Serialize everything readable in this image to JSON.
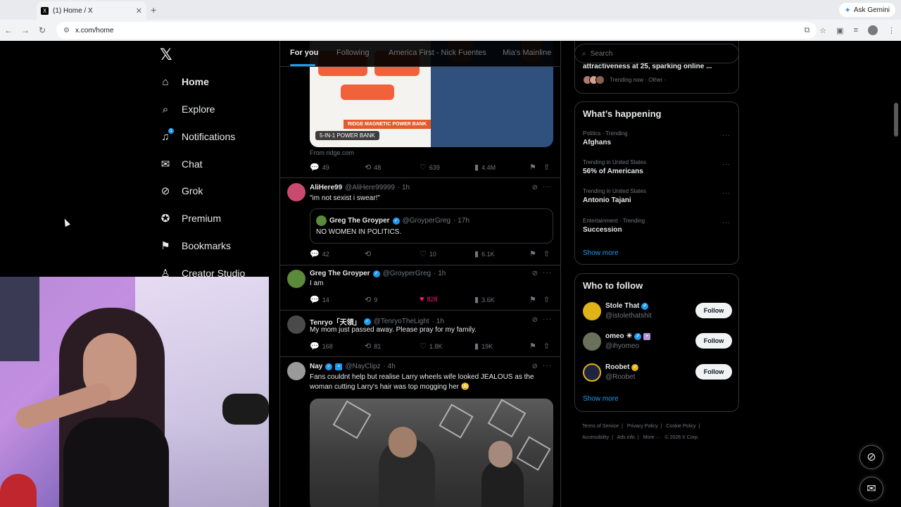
{
  "browser": {
    "tab_title": "(1) Home / X",
    "new_tab": "+",
    "tab_close": "✕",
    "address": "x.com/home",
    "gemini_label": "Ask Gemini"
  },
  "nav": {
    "logo": "𝕏",
    "items": [
      {
        "label": "Home",
        "icon": "home-icon"
      },
      {
        "label": "Explore",
        "icon": "search-icon"
      },
      {
        "label": "Notifications",
        "icon": "bell-icon",
        "badge": "1"
      },
      {
        "label": "Chat",
        "icon": "mail-icon"
      },
      {
        "label": "Grok",
        "icon": "grok-icon"
      },
      {
        "label": "Premium",
        "icon": "premium-icon"
      },
      {
        "label": "Bookmarks",
        "icon": "bookmark-icon"
      },
      {
        "label": "Creator Studio",
        "icon": "creator-studio-icon"
      }
    ]
  },
  "feed": {
    "tabs": [
      "For you",
      "Following",
      "America First - Nick Fuentes",
      "Mia's Mainline"
    ],
    "ad": {
      "badge": "RIDGE MAGNETIC POWER BANK",
      "label": "5-IN-1 POWER BANK",
      "from": "From ridge.com",
      "replies": "49",
      "reposts": "48",
      "likes": "639",
      "views": "4.4M"
    },
    "posts": [
      {
        "name": "AliHere99",
        "handle": "@AliHere99999",
        "time": "· 1h",
        "text": "\"im not sexist i swear!\"",
        "quote": {
          "name": "Greg The Groyper",
          "handle": "@GroyperGreg",
          "time": "· 17h",
          "text": "NO WOMEN IN POLITICS."
        },
        "replies": "42",
        "reposts": "",
        "likes": "10",
        "views": "6.1K"
      },
      {
        "name": "Greg The Groyper",
        "handle": "@GroyperGreg",
        "time": "· 1h",
        "text": "I am",
        "replies": "14",
        "reposts": "9",
        "likes": "828",
        "views": "3.6K"
      },
      {
        "name": "Tenryo「天領」",
        "handle": "@TenryoTheLight",
        "time": "· 1h",
        "text": "My mom just passed away. Please pray for my family.",
        "replies": "168",
        "reposts": "81",
        "likes": "1.8K",
        "views": "19K"
      },
      {
        "name": "Nay",
        "handle": "@NayClipz",
        "time": "· 4h",
        "text": "Fans couldnt help but realise Larry wheels wife looked JEALOUS as the woman cutting Larry's hair was top mogging her 😳"
      }
    ]
  },
  "sidebar": {
    "search_placeholder": "Search",
    "top_trend": {
      "title": "attractiveness at 25, sparking online ...",
      "meta": "Trending now · Other ·"
    },
    "happening_title": "What’s happening",
    "trends": [
      {
        "meta": "Politics · Trending",
        "name": "Afghans"
      },
      {
        "meta": "Trending in United States",
        "name": "56% of Americans"
      },
      {
        "meta": "Trending in United States",
        "name": "Antonio Tajani"
      },
      {
        "meta": "Entertainment · Trending",
        "name": "Succession"
      }
    ],
    "show_more": "Show more",
    "who_to_follow_title": "Who to follow",
    "follow": [
      {
        "name": "Stole That",
        "handle": "@istolethatshit",
        "badge": "blue"
      },
      {
        "name": "omeo ☀",
        "handle": "@ihyomeo",
        "badge": "blue"
      },
      {
        "name": "Roobet",
        "handle": "@Roobet",
        "badge": "gold"
      }
    ],
    "follow_label": "Follow",
    "footer": [
      "Terms of Service",
      "|",
      "Privacy Policy",
      "|",
      "Cookie Policy",
      "|",
      "Accessibility",
      "|",
      "Ads info",
      "|",
      "More ···",
      "© 2026 X Corp."
    ]
  },
  "colors": {
    "accent": "#1d9bf0",
    "like": "#f91880",
    "background": "#000000",
    "border": "#2f3336"
  }
}
